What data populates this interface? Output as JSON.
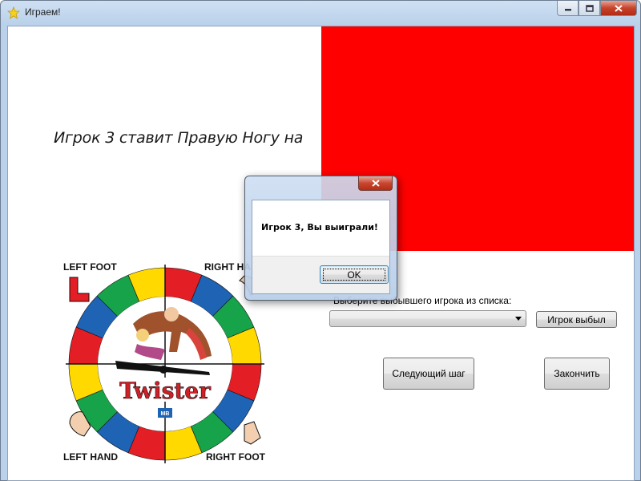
{
  "window": {
    "title": "Играем!",
    "icon": "star-icon"
  },
  "game": {
    "instruction": "Игрок 3 ставит Правую Ногу на",
    "current_color": "#ff0000"
  },
  "controls": {
    "choose_label": "Выберите выбывшего игрока из списка:",
    "player_select_value": "",
    "player_out_button": "Игрок выбыл",
    "next_step_button": "Следующий шаг",
    "finish_button": "Закончить"
  },
  "twister_image": {
    "left_foot": "LEFT FOOT",
    "right_hand": "RIGHT HAND",
    "left_hand": "LEFT HAND",
    "right_foot": "RIGHT FOOT",
    "logo": "Twister",
    "badge": "MB",
    "colors": [
      "#e31e24",
      "#1f63b5",
      "#17a34a",
      "#ffd900"
    ]
  },
  "dialog": {
    "message": "Игрок 3, Вы выиграли!",
    "ok_label": "OK"
  }
}
